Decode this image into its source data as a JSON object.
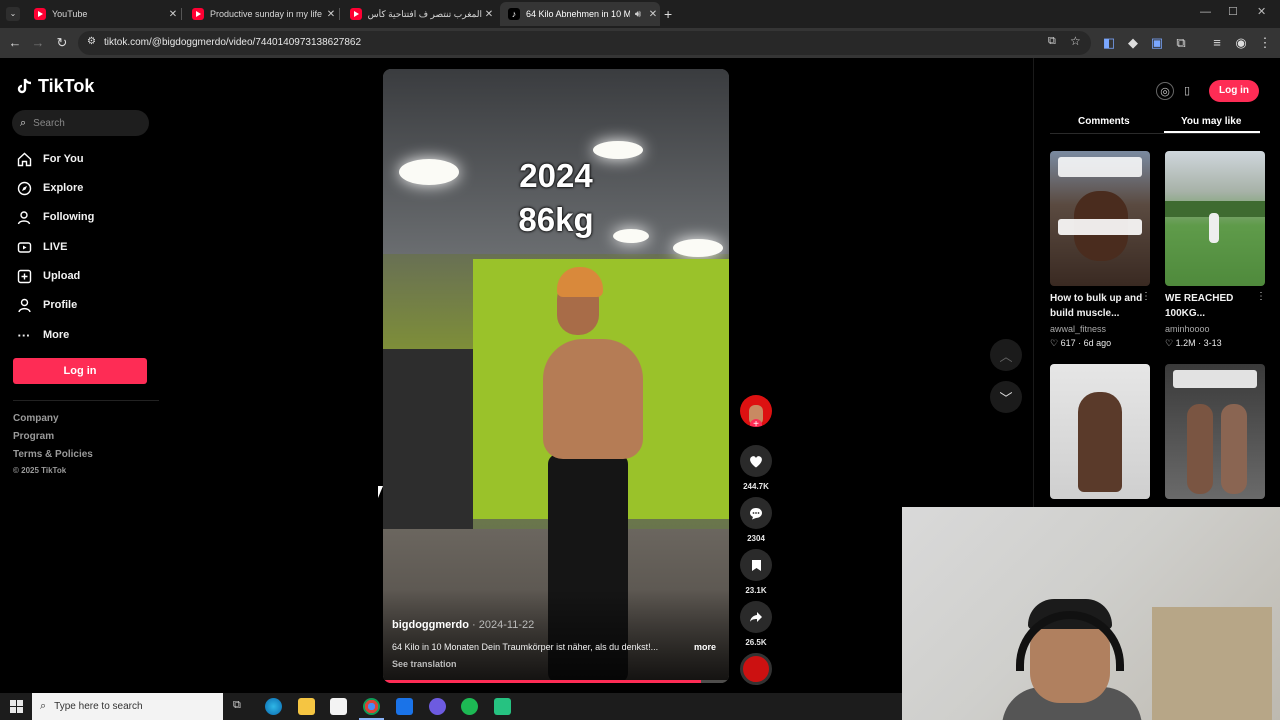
{
  "browser": {
    "tabs": [
      {
        "title": "YouTube",
        "favicon": "youtube-icon",
        "active": false
      },
      {
        "title": "Productive sunday in my life liv",
        "favicon": "youtube-icon",
        "active": false
      },
      {
        "title": "المغرب تنتصر ف افتتاحية كأس الأ",
        "favicon": "youtube-icon",
        "active": false
      },
      {
        "title": "64 Kilo Abnehmen in 10 Mo",
        "favicon": "tiktok-icon",
        "active": true
      }
    ],
    "url": "tiktok.com/@bigdoggmerdo/video/7440140973138627862"
  },
  "nav": {
    "logo": "TikTok",
    "search_placeholder": "Search",
    "items": [
      {
        "label": "For You",
        "icon": "home-icon"
      },
      {
        "label": "Explore",
        "icon": "compass-icon"
      },
      {
        "label": "Following",
        "icon": "person-icon"
      },
      {
        "label": "LIVE",
        "icon": "live-icon"
      },
      {
        "label": "Upload",
        "icon": "upload-icon"
      },
      {
        "label": "Profile",
        "icon": "profile-icon"
      },
      {
        "label": "More",
        "icon": "more-icon"
      }
    ],
    "login": "Log in",
    "footer": [
      "Company",
      "Program",
      "Terms & Policies",
      "© 2025 TikTok"
    ]
  },
  "video": {
    "overlay_year": "2024",
    "overlay_weight": "86kg",
    "author": "bigdoggmerdo",
    "date": "2024-11-22",
    "separator": " · ",
    "description": "64 Kilo in 10 Monaten Dein Traumkörper ist näher, als du denkst!...",
    "more": "more",
    "translation": "See translation",
    "progress_fraction": 0.92
  },
  "actions": {
    "likes": "244.7K",
    "comments": "2304",
    "saves": "23.1K",
    "shares": "26.5K"
  },
  "right": {
    "login": "Log in",
    "tabs": [
      "Comments",
      "You may like"
    ],
    "cards": [
      {
        "title": "How to bulk up and build muscle...",
        "user": "awwal_fitness",
        "likes": "617",
        "age": "6d ago"
      },
      {
        "title": "WE REACHED 100KG...",
        "user": "aminhoooo",
        "likes": "1.2M",
        "age": "3-13"
      }
    ]
  },
  "taskbar": {
    "search_placeholder": "Type here to search"
  },
  "colors": {
    "accent": "#fe2c55",
    "background": "#000000"
  }
}
